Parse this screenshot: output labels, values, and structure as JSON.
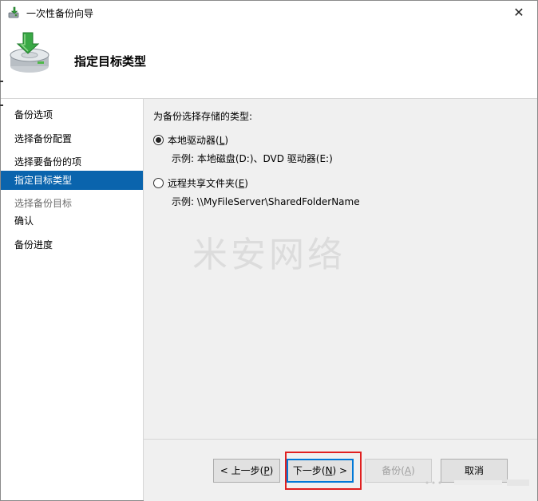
{
  "window": {
    "title": "一次性备份向导",
    "close_glyph": "✕",
    "icon": "backup-wizard-icon"
  },
  "header": {
    "title": "指定目标类型",
    "icon": "disk-backup-icon"
  },
  "nav": {
    "items": [
      {
        "label": "备份选项",
        "state": "normal"
      },
      {
        "label": "选择备份配置",
        "state": "normal"
      },
      {
        "label": "选择要备份的项",
        "state": "normal"
      },
      {
        "label": "指定目标类型",
        "state": "selected"
      },
      {
        "label": "选择备份目标",
        "state": "disabled"
      },
      {
        "label": "确认",
        "state": "normal"
      },
      {
        "label": "备份进度",
        "state": "normal"
      }
    ]
  },
  "content": {
    "prompt": "为备份选择存储的类型:",
    "options": [
      {
        "label": "本地驱动器(L)",
        "label_text": "本地驱动器(",
        "accel": "L",
        "close": ")",
        "example": "示例: 本地磁盘(D:)、DVD 驱动器(E:)",
        "checked": true
      },
      {
        "label": "远程共享文件夹(E)",
        "label_text": "远程共享文件夹(",
        "accel": "E",
        "close": ")",
        "example": "示例: \\\\MyFileServer\\SharedFolderName",
        "checked": false
      }
    ],
    "watermark": "米安网络"
  },
  "footer": {
    "back": {
      "pre": "< 上一步(",
      "accel": "P",
      "post": ")"
    },
    "next": {
      "pre": "下一步(",
      "accel": "N",
      "post": ") >"
    },
    "backup": {
      "pre": "备份(",
      "accel": "A",
      "post": ")"
    },
    "cancel": {
      "label": "取消"
    }
  },
  "colors": {
    "selection": "#0a64ad",
    "panel": "#f0f0f0",
    "highlight": "#e02020",
    "primary_border": "#0078d7"
  }
}
